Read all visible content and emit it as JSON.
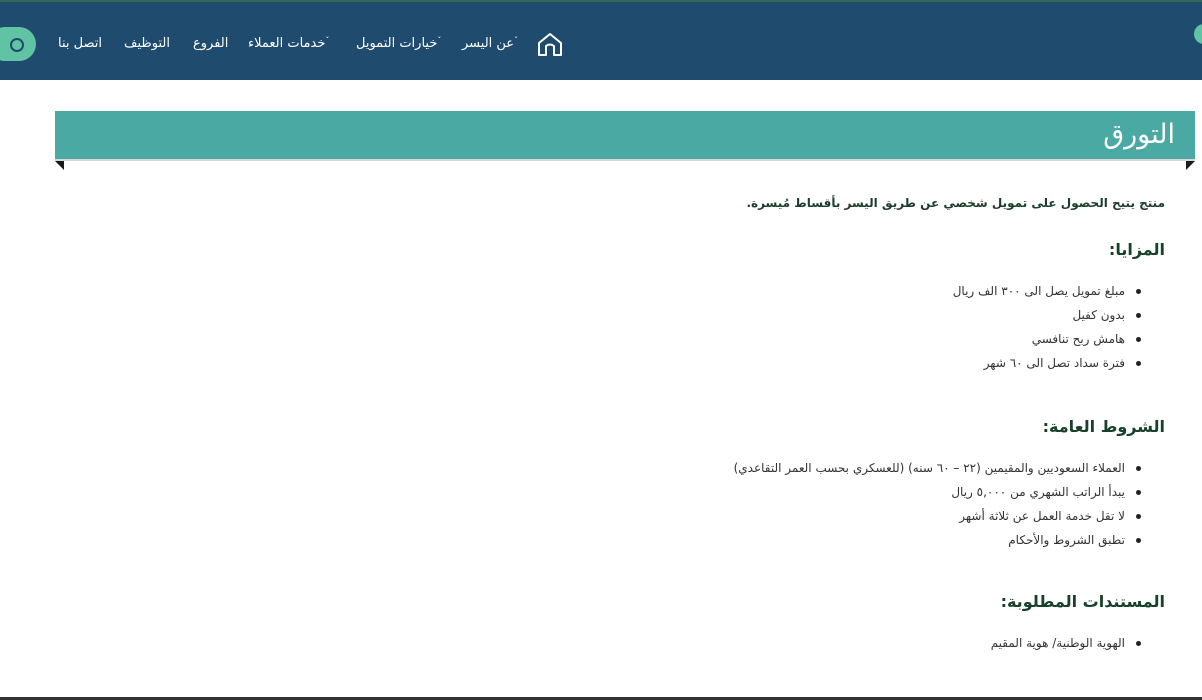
{
  "header": {
    "nav": {
      "about": "عن اليسر",
      "financing": "خيارات التمويل",
      "customer_services": "خدمات العملاء",
      "branches": "الفروع",
      "careers": "التوظيف",
      "contact": "اتصل بنا"
    },
    "dropdown_caret": "ˇ",
    "colors": {
      "bar": "#1f4b6e",
      "accent": "#5fc3a4"
    }
  },
  "banner": {
    "title": "التورق",
    "color": "#4aa9a2"
  },
  "page": {
    "intro": "منتج يتيح الحصول على تمويل شخصي عن طريق اليسر بأقساط مُيسرة.",
    "advantages": {
      "title": "المزايا:",
      "items": [
        "مبلغ تمويل يصل الى ٣٠٠ الف ريال",
        "بدون كفيل",
        "هامش ربح تنافسي",
        "فترة سداد تصل الى ٦٠ شهر"
      ]
    },
    "conditions": {
      "title": "الشروط العامة:",
      "items": [
        "العملاء السعوديين والمقيمين (٢٢ – ٦٠ سنه) (للعسكري بحسب العمر التقاعدي)",
        "يبدأ الراتب الشهري من ٥,٠٠٠ ريال",
        "لا تقل خدمة العمل عن ثلاثة أشهر",
        "تطبق الشروط والأحكام"
      ]
    },
    "documents": {
      "title": "المستندات المطلوبة:",
      "items": [
        "الهوية الوطنية/ هوية المقيم"
      ]
    }
  }
}
